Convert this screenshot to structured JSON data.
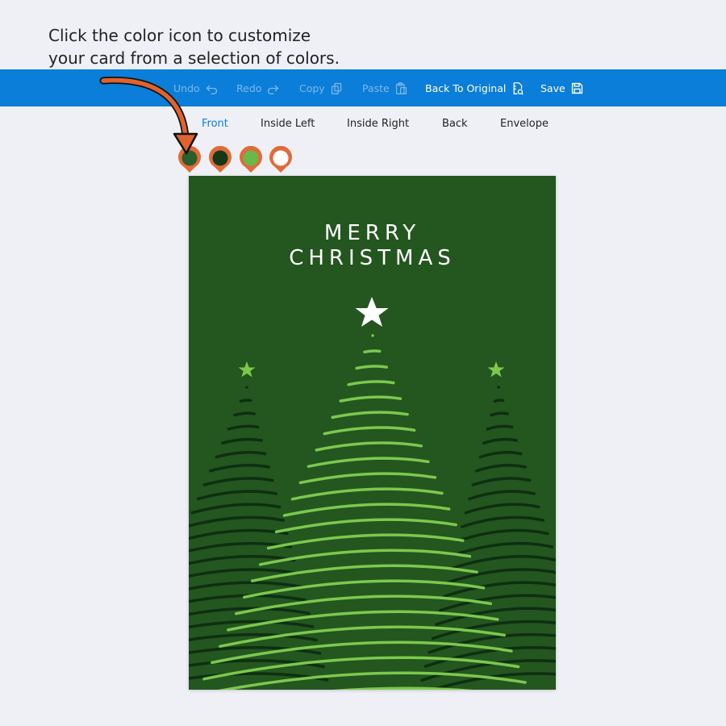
{
  "instruction": {
    "line1": "Click the color icon to customize",
    "line2": "your card from a selection of colors."
  },
  "toolbar": {
    "undo_label": "Undo",
    "redo_label": "Redo",
    "copy_label": "Copy",
    "paste_label": "Paste",
    "back_to_original_label": "Back To Original",
    "save_label": "Save",
    "bar_color": "#0a7ed9"
  },
  "tabs": [
    {
      "label": "Front",
      "active": true
    },
    {
      "label": "Inside Left",
      "active": false
    },
    {
      "label": "Inside Right",
      "active": false
    },
    {
      "label": "Back",
      "active": false
    },
    {
      "label": "Envelope",
      "active": false
    }
  ],
  "swatches": [
    {
      "color": "#2a5e2a"
    },
    {
      "color": "#143818"
    },
    {
      "color": "#6bb84a"
    },
    {
      "color": "#ffffff"
    }
  ],
  "swatch_ring_color": "#e26a3a",
  "card": {
    "line1": "MERRY",
    "line2": "CHRISTMAS",
    "background": "#24561f",
    "light_green": "#7cc84e",
    "dark_green": "#0e2f11"
  },
  "arrow_color": "#e0632e"
}
